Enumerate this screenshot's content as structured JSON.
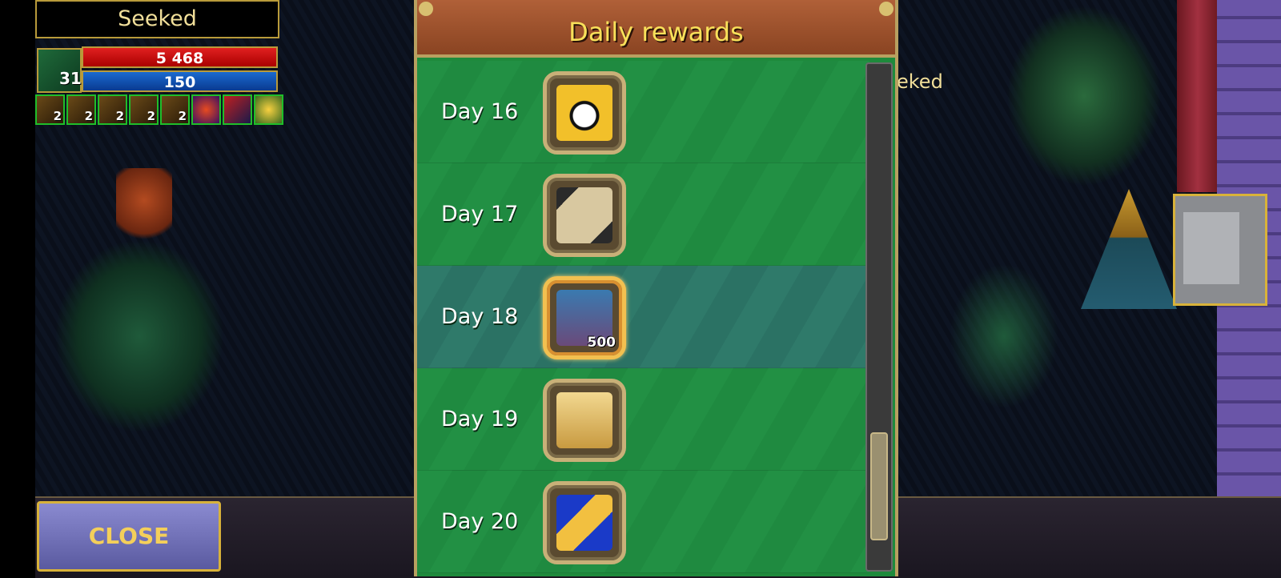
{
  "hud": {
    "player_name": "Seeked",
    "level": "31",
    "hp": "5 468",
    "mp": "150",
    "buffs": [
      {
        "icon": "golden-fist-icon",
        "count": "2"
      },
      {
        "icon": "golden-armor-icon",
        "count": "2"
      },
      {
        "icon": "gauntlet-icon",
        "count": "2"
      },
      {
        "icon": "star-wand-icon",
        "count": "2"
      },
      {
        "icon": "golden-boots-icon",
        "count": "2"
      },
      {
        "icon": "fire-orb-icon",
        "count": ""
      },
      {
        "icon": "crossed-swords-icon",
        "count": ""
      },
      {
        "icon": "sun-icon",
        "count": ""
      }
    ],
    "other_player_name": "eked"
  },
  "close_button": {
    "label": "CLOSE"
  },
  "panel": {
    "title": "Daily rewards",
    "rows": [
      {
        "day": "Day 16",
        "reward_icon": "yin-yang-flask-icon",
        "quantity": "",
        "current": false
      },
      {
        "day": "Day 17",
        "reward_icon": "scroll-ribbon-icon",
        "quantity": "",
        "current": false
      },
      {
        "day": "Day 18",
        "reward_icon": "spell-book-icon",
        "quantity": "500",
        "current": true
      },
      {
        "day": "Day 19",
        "reward_icon": "golden-parchment-icon",
        "quantity": "",
        "current": false
      },
      {
        "day": "Day 20",
        "reward_icon": "blue-scroll-icon",
        "quantity": "",
        "current": false
      }
    ]
  },
  "colors": {
    "panel_green": "#1e8a3c",
    "current_row": "#2f7a6a",
    "title_yellow": "#f8e05a",
    "gold_border": "#d8b23a"
  }
}
